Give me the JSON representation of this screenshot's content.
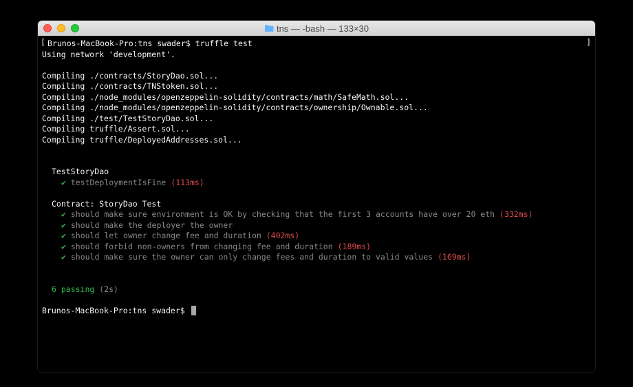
{
  "window": {
    "title": "tns — -bash — 133×30"
  },
  "prompt1": {
    "host": "Brunos-MacBook-Pro:tns swader$ ",
    "command": "truffle test"
  },
  "output": {
    "using_network": "Using network 'development'.",
    "compiling": [
      "Compiling ./contracts/StoryDao.sol...",
      "Compiling ./contracts/TNStoken.sol...",
      "Compiling ./node_modules/openzeppelin-solidity/contracts/math/SafeMath.sol...",
      "Compiling ./node_modules/openzeppelin-solidity/contracts/ownership/Ownable.sol...",
      "Compiling ./test/TestStoryDao.sol...",
      "Compiling truffle/Assert.sol...",
      "Compiling truffle/DeployedAddresses.sol..."
    ]
  },
  "suite1": {
    "name": "TestStoryDao",
    "tests": [
      {
        "check": "✔",
        "name": " testDeploymentIsFine ",
        "timing": "(113ms)",
        "slow": true
      }
    ]
  },
  "suite2": {
    "name": "Contract: StoryDao Test",
    "tests": [
      {
        "check": "✔",
        "name": " should make sure environment is OK by checking that the first 3 accounts have over 20 eth ",
        "timing": "(332ms)",
        "slow": true
      },
      {
        "check": "✔",
        "name": " should make the deployer the owner",
        "timing": "",
        "slow": false
      },
      {
        "check": "✔",
        "name": " should let owner change fee and duration ",
        "timing": "(402ms)",
        "slow": true
      },
      {
        "check": "✔",
        "name": " should forbid non-owners from changing fee and duration ",
        "timing": "(189ms)",
        "slow": true
      },
      {
        "check": "✔",
        "name": " should make sure the owner can only change fees and duration to valid values ",
        "timing": "(169ms)",
        "slow": true
      }
    ]
  },
  "summary": {
    "passing": "6 passing ",
    "time": "(2s)"
  },
  "prompt2": {
    "host": "Brunos-MacBook-Pro:tns swader$ "
  }
}
